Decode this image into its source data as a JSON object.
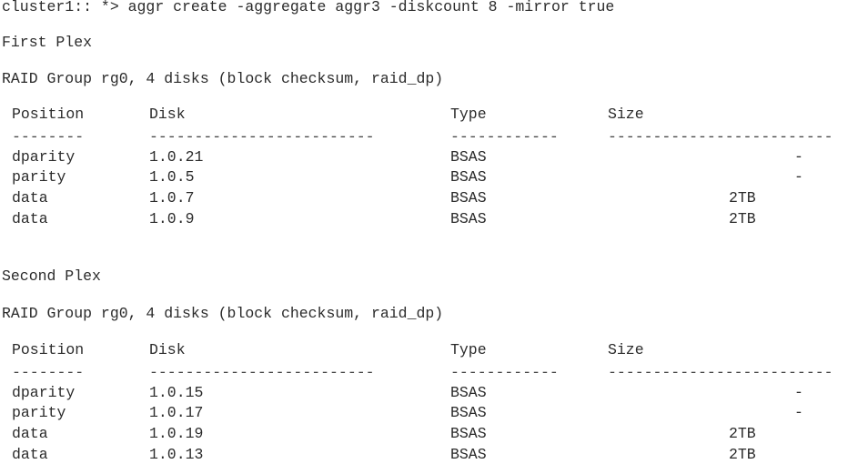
{
  "command": "cluster1:: *> aggr create -aggregate aggr3 -diskcount 8 -mirror true",
  "plexes": [
    {
      "title": "First Plex",
      "raid_group": "RAID Group rg0, 4 disks (block checksum, raid_dp)",
      "headers": {
        "position": "Position",
        "disk": "Disk",
        "type": "Type",
        "size": "Size"
      },
      "separators": {
        "position": "--------",
        "disk": "-------------------------",
        "type": "------------",
        "size": "-------------------------"
      },
      "rows": [
        {
          "position": "dparity",
          "disk": "1.0.21",
          "type": "BSAS",
          "size": "-"
        },
        {
          "position": "parity",
          "disk": "1.0.5",
          "type": "BSAS",
          "size": "-"
        },
        {
          "position": "data",
          "disk": "1.0.7",
          "type": "BSAS",
          "size": "2TB"
        },
        {
          "position": "data",
          "disk": "1.0.9",
          "type": "BSAS",
          "size": "2TB"
        }
      ]
    },
    {
      "title": "Second Plex",
      "raid_group": "RAID Group rg0, 4 disks (block checksum, raid_dp)",
      "headers": {
        "position": "Position",
        "disk": "Disk",
        "type": "Type",
        "size": "Size"
      },
      "separators": {
        "position": "--------",
        "disk": "-------------------------",
        "type": "------------",
        "size": "-------------------------"
      },
      "rows": [
        {
          "position": "dparity",
          "disk": "1.0.15",
          "type": "BSAS",
          "size": "-"
        },
        {
          "position": "parity",
          "disk": "1.0.17",
          "type": "BSAS",
          "size": "-"
        },
        {
          "position": "data",
          "disk": "1.0.19",
          "type": "BSAS",
          "size": "2TB"
        },
        {
          "position": "data",
          "disk": "1.0.13",
          "type": "BSAS",
          "size": "2TB"
        }
      ]
    }
  ]
}
